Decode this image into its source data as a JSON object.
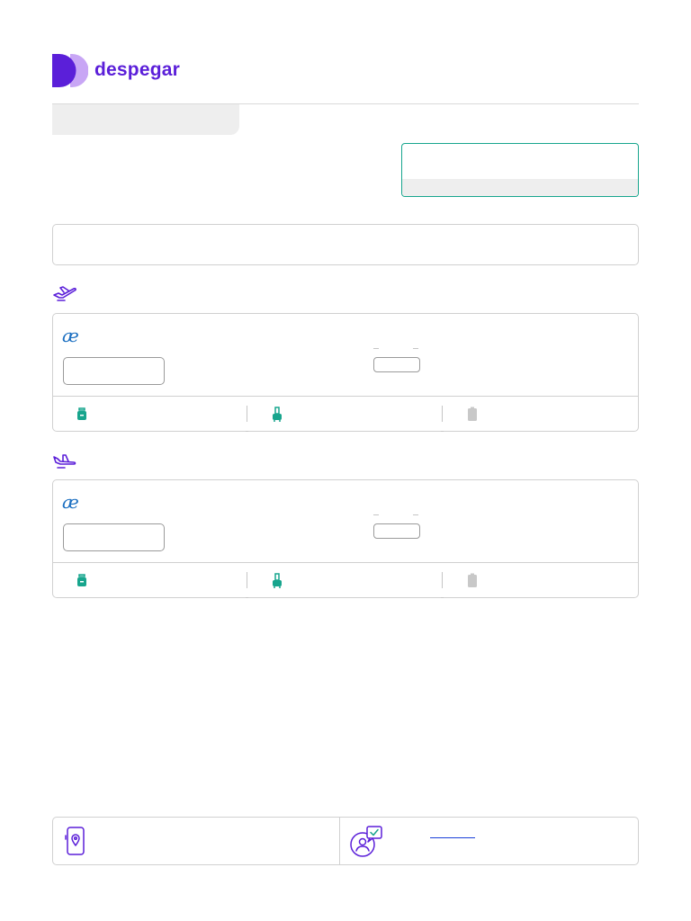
{
  "brand": {
    "name": "despegar",
    "color": "#5b1fd9",
    "color_light": "#c8a6f5"
  },
  "colors": {
    "accent_teal": "#17a58d",
    "bag_included": "#17a58d",
    "bag_not_included": "#c8c8c8",
    "airline_blue": "#1b6fc1",
    "purple": "#5b1fd9",
    "link_blue": "#1a3fd9"
  },
  "sections": [
    {
      "direction": "outbound",
      "icon": "plane-takeoff-icon"
    },
    {
      "direction": "return",
      "icon": "plane-landing-icon"
    }
  ],
  "flights": [
    {
      "airline_logo": "æ",
      "baggage": [
        {
          "type": "personal-item-icon",
          "included": true
        },
        {
          "type": "carry-on-icon",
          "included": true
        },
        {
          "type": "checked-bag-icon",
          "included": false
        }
      ]
    },
    {
      "airline_logo": "æ",
      "baggage": [
        {
          "type": "personal-item-icon",
          "included": true
        },
        {
          "type": "carry-on-icon",
          "included": true
        },
        {
          "type": "checked-bag-icon",
          "included": false
        }
      ]
    }
  ],
  "footer": {
    "left_icon": "phone-location-icon",
    "right_icon": "support-chat-icon"
  }
}
